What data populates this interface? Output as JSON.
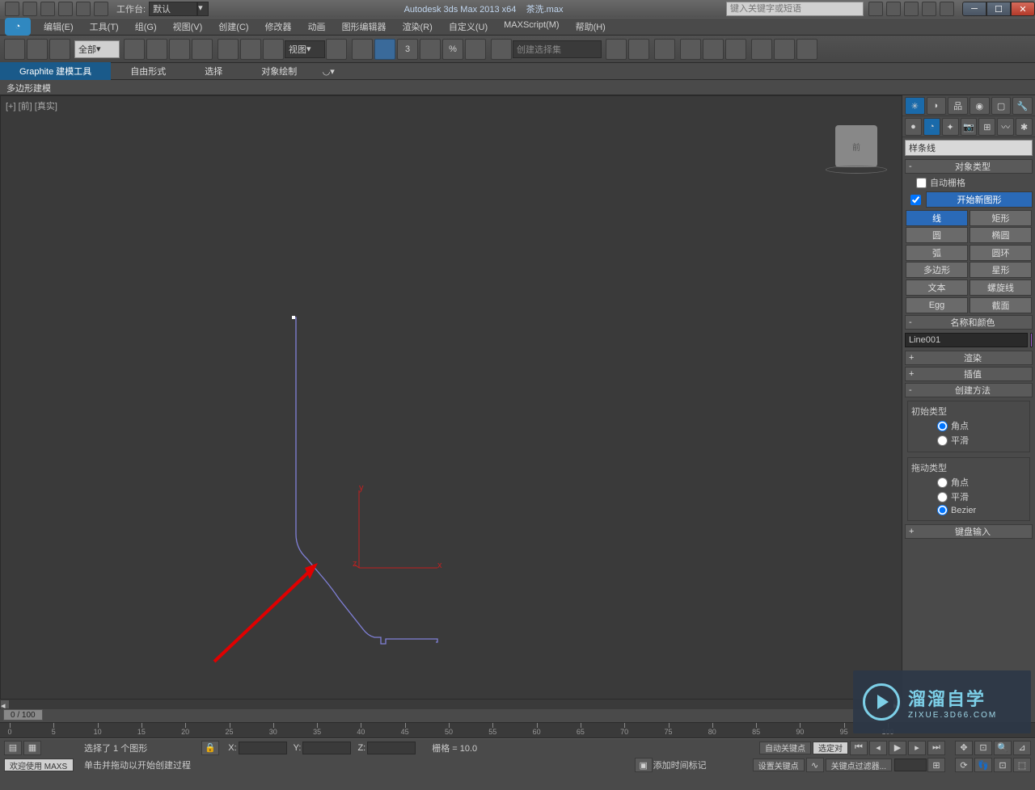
{
  "titlebar": {
    "workspace_label": "工作台:",
    "workspace_value": "默认",
    "app_title": "Autodesk 3ds Max  2013 x64",
    "doc_title": "茶洗.max",
    "search_placeholder": "键入关键字或短语"
  },
  "menu": {
    "items": [
      "编辑(E)",
      "工具(T)",
      "组(G)",
      "视图(V)",
      "创建(C)",
      "修改器",
      "动画",
      "图形编辑器",
      "渲染(R)",
      "自定义(U)",
      "MAXScript(M)",
      "帮助(H)"
    ]
  },
  "toolbar": {
    "filter_value": "全部",
    "view_dd": "视图",
    "selset_placeholder": "创建选择集"
  },
  "ribbon": {
    "tabs": [
      "Graphite 建模工具",
      "自由形式",
      "选择",
      "对象绘制"
    ],
    "row2": "多边形建模"
  },
  "viewport": {
    "label": "[+] [前] [真实]",
    "viewcube": "前"
  },
  "cmd": {
    "category": "样条线",
    "rollouts": {
      "obj_type": "对象类型",
      "auto_grid": "自动栅格",
      "start_new": "开始新图形",
      "name_color": "名称和颜色",
      "render": "渲染",
      "interp": "插值",
      "create_method": "创建方法",
      "keyboard": "键盘输入"
    },
    "obj_buttons": [
      "线",
      "矩形",
      "圆",
      "椭圆",
      "弧",
      "圆环",
      "多边形",
      "星形",
      "文本",
      "螺旋线",
      "Egg",
      "截面"
    ],
    "obj_active": "线",
    "name_value": "Line001",
    "method": {
      "init_label": "初始类型",
      "drag_label": "拖动类型",
      "options": [
        "角点",
        "平滑",
        "Bezier"
      ],
      "init_sel": "角点",
      "drag_sel": "Bezier"
    }
  },
  "timeline": {
    "slider": "0 / 100",
    "ticks": [
      0,
      5,
      10,
      15,
      20,
      25,
      30,
      35,
      40,
      45,
      50,
      55,
      60,
      65,
      70,
      75,
      80,
      85,
      90,
      95,
      100
    ]
  },
  "status": {
    "sel_text": "选择了 1 个图形",
    "hint": "单击并拖动以开始创建过程",
    "welcome": "欢迎使用  MAXS",
    "x": "X:",
    "y": "Y:",
    "z": "Z:",
    "grid": "栅格 = 10.0",
    "add_marker": "添加时间标记",
    "auto_key": "自动关键点",
    "set_key": "设置关键点",
    "sel_obj": "选定对",
    "key_filter": "关键点过滤器..."
  },
  "watermark": {
    "big": "溜溜自学",
    "small": "ZIXUE.3D66.COM"
  }
}
